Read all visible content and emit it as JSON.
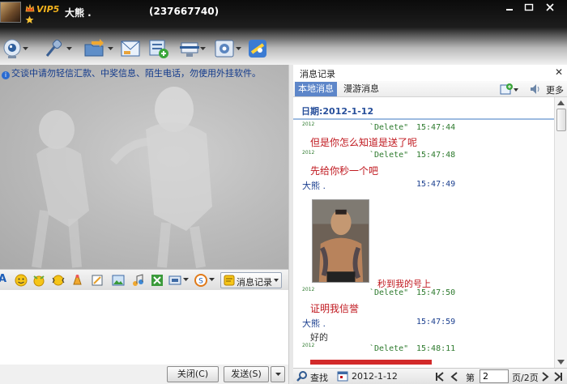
{
  "window": {
    "vip_label": "VIP5",
    "buddy_name": "大熊 .",
    "buddy_qq": "(237667740)"
  },
  "toolbar": {
    "icons": [
      "video-call-icon",
      "voice-call-icon",
      "send-file-icon",
      "send-mail-icon",
      "create-group-icon",
      "remote-assist-icon",
      "apps-icon",
      "qq-zone-icon"
    ]
  },
  "chat": {
    "notice": "交谈中请勿轻信汇款、中奖信息、陌生电话，勿使用外挂软件。"
  },
  "format_bar": {
    "history_button_label": "消息记录"
  },
  "bottom": {
    "close_label": "关闭(C)",
    "send_label": "发送(S)"
  },
  "history": {
    "title": "消息记录",
    "tab_local": "本地消息",
    "tab_roam": "漫游消息",
    "more_label": "更多",
    "date_label": "日期:2012-1-12",
    "messages": [
      {
        "year": "2012",
        "sender": "`Delete\"",
        "time": "15:47:44",
        "text": "但是你怎么知道是送了呢"
      },
      {
        "year": "2012",
        "sender": "`Delete\"",
        "time": "15:47:48",
        "text": "先给你秒一个吧"
      },
      {
        "sender": "大熊 .",
        "time": "15:47:49",
        "caption": "秒到我的号上"
      },
      {
        "year": "2012",
        "sender": "`Delete\"",
        "time": "15:47:50",
        "text": "证明我信誉"
      },
      {
        "sender": "大熊 .",
        "time": "15:47:59",
        "text": "好的"
      },
      {
        "year": "2012",
        "sender": "`Delete\"",
        "time": "15:48:11"
      }
    ],
    "footer": {
      "find_label": "查找",
      "date": "2012-1-12",
      "page_prefix": "第",
      "page_value": "2",
      "page_suffix": "页/2页"
    }
  }
}
